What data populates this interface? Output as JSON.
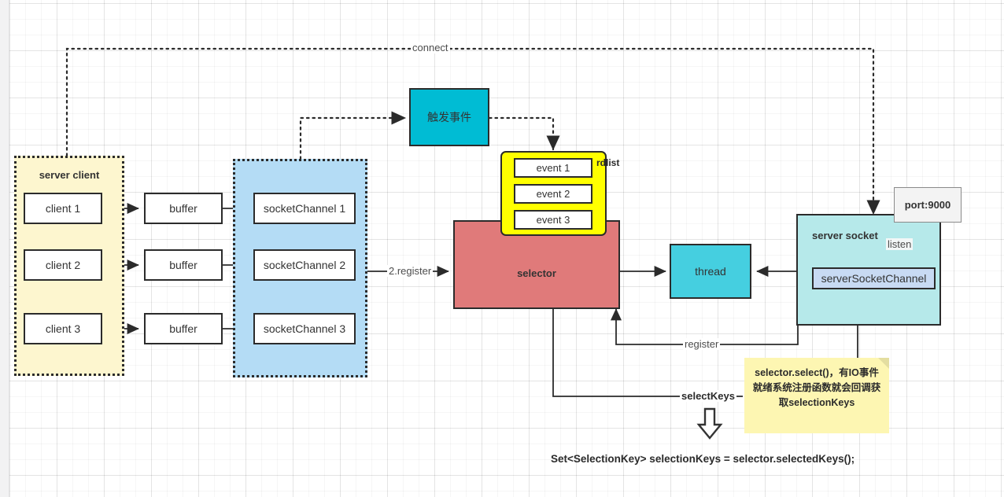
{
  "diagram": {
    "title": "NIO selector diagram",
    "colors": {
      "client_group_bg": "#fdf6cf",
      "channel_group_bg": "#b4dcf5",
      "selector_bg": "#e07a7a",
      "event_list_bg": "#ffff00",
      "trigger_bg": "#00bcd4",
      "thread_bg": "#45cfe0",
      "server_socket_bg": "#b6e9ea",
      "server_socket_channel_bg": "#c8daf3",
      "note_bg": "#fdf6b2",
      "stroke": "#2b2b2b"
    },
    "client_group": {
      "title": "server client",
      "clients": [
        {
          "label": "client 1"
        },
        {
          "label": "client 2"
        },
        {
          "label": "client 3"
        }
      ]
    },
    "buffers": [
      {
        "label": "buffer"
      },
      {
        "label": "buffer"
      },
      {
        "label": "buffer"
      }
    ],
    "channel_group": {
      "channels": [
        {
          "label": "socketChannel 1"
        },
        {
          "label": "socketChannel 2"
        },
        {
          "label": "socketChannel 3"
        }
      ]
    },
    "trigger_box": {
      "label": "触发事件"
    },
    "event_list": {
      "name": "rdlist",
      "events": [
        {
          "label": "event 1"
        },
        {
          "label": "event 2"
        },
        {
          "label": "event 3"
        }
      ]
    },
    "selector": {
      "label": "selector"
    },
    "thread": {
      "label": "thread"
    },
    "server_socket": {
      "title": "server socket",
      "channel_label": "serverSocketChannel",
      "listen_label": "listen",
      "port_label": "port:9000"
    },
    "edges": {
      "connect": "connect",
      "register_number": "2.register",
      "register": "register",
      "select_keys": "selectKeys"
    },
    "note": {
      "text": "selector.select()，有IO事件就绪系统注册函数就会回调获取selectionKeys"
    },
    "code_line": "Set<SelectionKey> selectionKeys = selector.selectedKeys();",
    "down_arrow_icon": "⇩"
  }
}
